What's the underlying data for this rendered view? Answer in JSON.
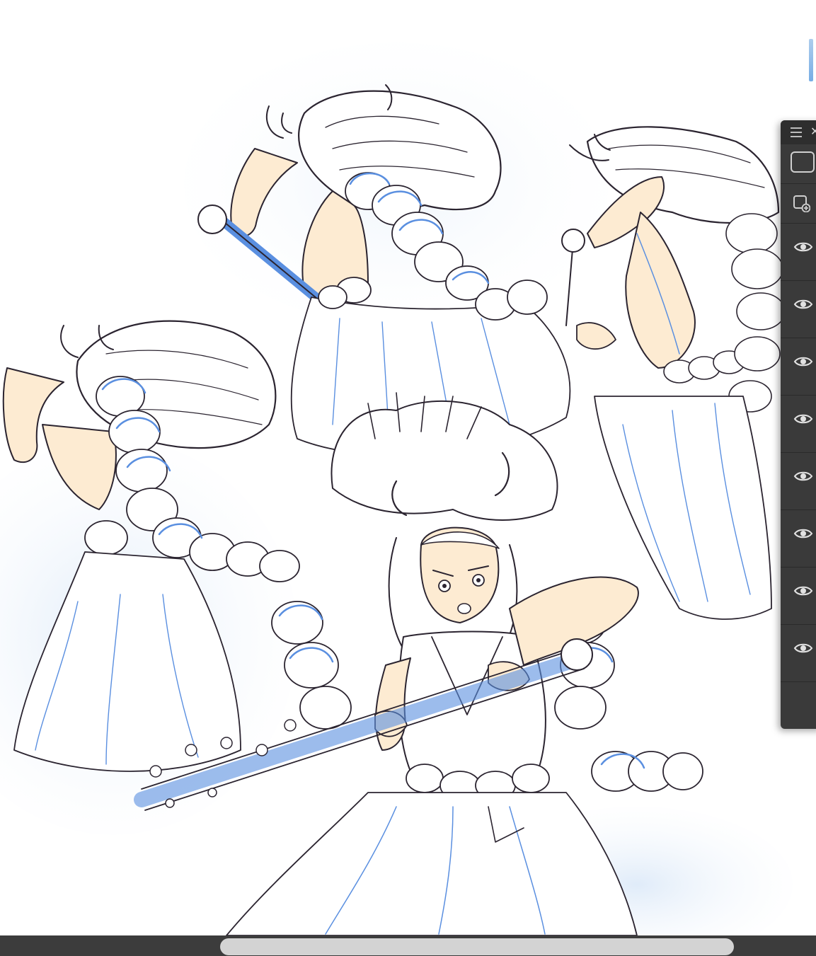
{
  "app": {
    "name": "drawing-app"
  },
  "canvas": {
    "ink_color": "#2b2430",
    "sketch_color": "#5a8fe0",
    "skin_color": "#fdebd2",
    "hair_fill": "#ffffff"
  },
  "layer_panel": {
    "menu_icon": "hamburger-icon",
    "close_icon": "close-icon",
    "close_glyph": "✕",
    "tools": [
      "layer-thumbnail-icon",
      "new-layer-icon"
    ],
    "layers": [
      {
        "visible": true
      },
      {
        "visible": true
      },
      {
        "visible": true
      },
      {
        "visible": true
      },
      {
        "visible": true
      },
      {
        "visible": true
      },
      {
        "visible": true
      },
      {
        "visible": true
      }
    ]
  },
  "scrollbar": {
    "position_fraction": 0.27,
    "thumb_fraction": 0.63
  }
}
